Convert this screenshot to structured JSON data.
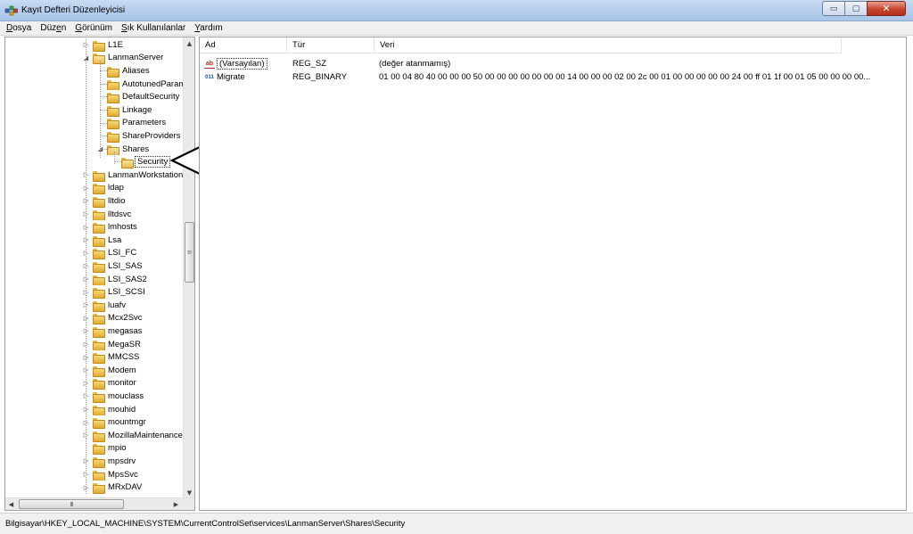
{
  "window": {
    "title": "Kayıt Defteri Düzenleyicisi",
    "minimize_glyph": "▭",
    "maximize_glyph": "▢",
    "close_glyph": "✕"
  },
  "menu": [
    {
      "accel": "D",
      "rest": "osya"
    },
    {
      "pre": "Düz",
      "accel": "e",
      "rest": "n"
    },
    {
      "accel": "G",
      "rest": "örünüm"
    },
    {
      "accel": "S",
      "rest": "ık Kullanılanlar"
    },
    {
      "accel": "Y",
      "rest": "ardım"
    }
  ],
  "tree": {
    "items": [
      {
        "label": "L1E",
        "expander": "▷",
        "level": 0
      },
      {
        "label": "LanmanServer",
        "expander": "◢",
        "level": 0,
        "open": true
      },
      {
        "label": "Aliases",
        "expander": "",
        "level": 1
      },
      {
        "label": "AutotunedParameters",
        "expander": "",
        "level": 1
      },
      {
        "label": "DefaultSecurity",
        "expander": "",
        "level": 1
      },
      {
        "label": "Linkage",
        "expander": "",
        "level": 1
      },
      {
        "label": "Parameters",
        "expander": "",
        "level": 1
      },
      {
        "label": "ShareProviders",
        "expander": "",
        "level": 1
      },
      {
        "label": "Shares",
        "expander": "◢",
        "level": 1,
        "open": true
      },
      {
        "label": "Security",
        "expander": "",
        "level": 2,
        "selected": true
      },
      {
        "label": "LanmanWorkstation",
        "expander": "▷",
        "level": 0
      },
      {
        "label": "ldap",
        "expander": "▷",
        "level": 0
      },
      {
        "label": "lltdio",
        "expander": "▷",
        "level": 0
      },
      {
        "label": "lltdsvc",
        "expander": "▷",
        "level": 0
      },
      {
        "label": "lmhosts",
        "expander": "▷",
        "level": 0
      },
      {
        "label": "Lsa",
        "expander": "▷",
        "level": 0
      },
      {
        "label": "LSI_FC",
        "expander": "▷",
        "level": 0
      },
      {
        "label": "LSI_SAS",
        "expander": "▷",
        "level": 0
      },
      {
        "label": "LSI_SAS2",
        "expander": "▷",
        "level": 0
      },
      {
        "label": "LSI_SCSI",
        "expander": "▷",
        "level": 0
      },
      {
        "label": "luafv",
        "expander": "▷",
        "level": 0
      },
      {
        "label": "Mcx2Svc",
        "expander": "▷",
        "level": 0
      },
      {
        "label": "megasas",
        "expander": "▷",
        "level": 0
      },
      {
        "label": "MegaSR",
        "expander": "▷",
        "level": 0
      },
      {
        "label": "MMCSS",
        "expander": "▷",
        "level": 0
      },
      {
        "label": "Modem",
        "expander": "▷",
        "level": 0
      },
      {
        "label": "monitor",
        "expander": "▷",
        "level": 0
      },
      {
        "label": "mouclass",
        "expander": "▷",
        "level": 0
      },
      {
        "label": "mouhid",
        "expander": "▷",
        "level": 0
      },
      {
        "label": "mountmgr",
        "expander": "▷",
        "level": 0
      },
      {
        "label": "MozillaMaintenanceService",
        "expander": "▷",
        "level": 0
      },
      {
        "label": "mpio",
        "expander": "",
        "level": 0
      },
      {
        "label": "mpsdrv",
        "expander": "▷",
        "level": 0
      },
      {
        "label": "MpsSvc",
        "expander": "▷",
        "level": 0
      },
      {
        "label": "MRxDAV",
        "expander": "▷",
        "level": 0
      }
    ],
    "scroll_up_glyph": "▲",
    "scroll_down_glyph": "▼",
    "scroll_left_glyph": "◀",
    "scroll_right_glyph": "▶",
    "thumb_grip": "≡",
    "hthumb_grip": "III"
  },
  "values": {
    "columns": [
      "Ad",
      "Tür",
      "Veri"
    ],
    "rows": [
      {
        "icon": "string-value-icon",
        "icon_glyph": "ab",
        "name": "(Varsayılan)",
        "type": "REG_SZ",
        "data": "(değer atanmamış)"
      },
      {
        "icon": "binary-value-icon",
        "icon_glyph": "011",
        "name": "Migrate",
        "type": "REG_BINARY",
        "data": "01 00 04 80 40 00 00 00 50 00 00 00 00 00 00 00 14 00 00 00 02 00 2c 00 01 00 00 00 00 00 24 00 ff 01 1f 00 01 05 00 00 00 00..."
      }
    ]
  },
  "statusbar": {
    "path": "Bilgisayar\\HKEY_LOCAL_MACHINE\\SYSTEM\\CurrentControlSet\\services\\LanmanServer\\Shares\\Security"
  },
  "colors": {
    "titlebar": "#b7cfec",
    "close_button": "#c7452e",
    "folder": "#e8b84a"
  }
}
